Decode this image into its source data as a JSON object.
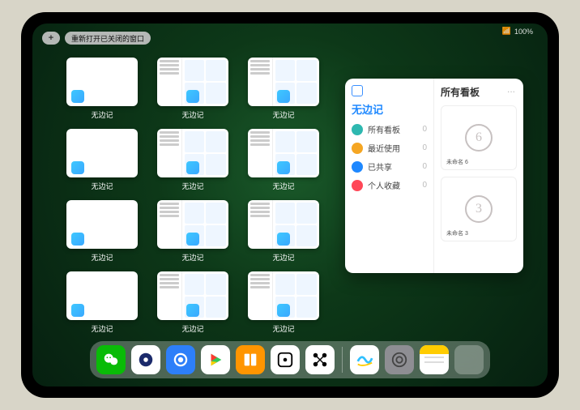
{
  "status": {
    "battery": "100%",
    "signal": "•••"
  },
  "toolbar": {
    "plus_label": "+",
    "reopen_label": "重新打开已关闭的窗口"
  },
  "thumbs": [
    {
      "label": "无边记",
      "style": "blank"
    },
    {
      "label": "无边记",
      "style": "content"
    },
    {
      "label": "无边记",
      "style": "content"
    },
    {
      "label": "无边记",
      "style": "blank"
    },
    {
      "label": "无边记",
      "style": "content"
    },
    {
      "label": "无边记",
      "style": "content"
    },
    {
      "label": "无边记",
      "style": "blank"
    },
    {
      "label": "无边记",
      "style": "content"
    },
    {
      "label": "无边记",
      "style": "content"
    },
    {
      "label": "无边记",
      "style": "blank"
    },
    {
      "label": "无边记",
      "style": "content"
    },
    {
      "label": "无边记",
      "style": "content"
    }
  ],
  "popup": {
    "left_title": "无边记",
    "right_title": "所有看板",
    "menu_icon": "...",
    "rows": [
      {
        "icon_color": "#2eb8b0",
        "label": "所有看板",
        "count": "0"
      },
      {
        "icon_color": "#f5a623",
        "label": "最近使用",
        "count": "0"
      },
      {
        "icon_color": "#1e88ff",
        "label": "已共享",
        "count": "0"
      },
      {
        "icon_color": "#ff4757",
        "label": "个人收藏",
        "count": "0"
      }
    ],
    "cards": [
      {
        "number": "6",
        "caption": "未命名 6"
      },
      {
        "number": "3",
        "caption": "未命名 3"
      }
    ]
  },
  "dock": {
    "apps": [
      {
        "name": "wechat",
        "bg": "#09bb07"
      },
      {
        "name": "quark-blue",
        "bg": "#ffffff"
      },
      {
        "name": "browser-q",
        "bg": "#2d7ff9"
      },
      {
        "name": "play-video",
        "bg": "#ffffff"
      },
      {
        "name": "books",
        "bg": "#ff9500"
      },
      {
        "name": "dice",
        "bg": "#ffffff"
      },
      {
        "name": "graph-dots",
        "bg": "#ffffff"
      },
      {
        "name": "freeform",
        "bg": "#ffffff"
      },
      {
        "name": "settings",
        "bg": "#8e8e93"
      },
      {
        "name": "notes",
        "bg": "#ffffff"
      },
      {
        "name": "recent-grid",
        "bg": "transparent"
      }
    ]
  }
}
